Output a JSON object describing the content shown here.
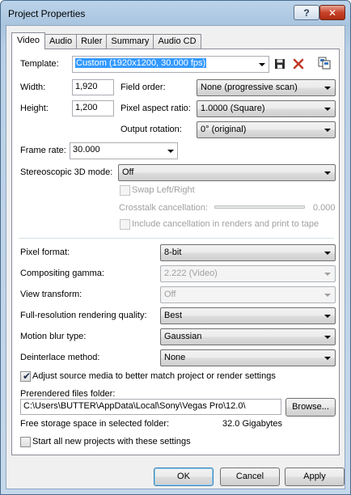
{
  "window": {
    "title": "Project Properties",
    "help_glyph": "?",
    "close_glyph": "✕"
  },
  "tabs": [
    {
      "label": "Video",
      "active": true
    },
    {
      "label": "Audio"
    },
    {
      "label": "Ruler"
    },
    {
      "label": "Summary"
    },
    {
      "label": "Audio CD"
    }
  ],
  "template": {
    "label": "Template:",
    "value": "Custom (1920x1200, 30.000 fps)"
  },
  "width": {
    "label": "Width:",
    "value": "1,920"
  },
  "height": {
    "label": "Height:",
    "value": "1,200"
  },
  "field_order": {
    "label": "Field order:",
    "value": "None (progressive scan)"
  },
  "pixel_aspect": {
    "label": "Pixel aspect ratio:",
    "value": "1.0000 (Square)"
  },
  "output_rotation": {
    "label": "Output rotation:",
    "value": "0° (original)"
  },
  "frame_rate": {
    "label": "Frame rate:",
    "value": "30.000"
  },
  "stereo_3d": {
    "label": "Stereoscopic 3D mode:",
    "value": "Off"
  },
  "swap_lr": {
    "label": "Swap Left/Right",
    "checked": false
  },
  "crosstalk": {
    "label": "Crosstalk cancellation:",
    "value": "0.000"
  },
  "include_cancellation": {
    "label": "Include cancellation in renders and print to tape",
    "checked": false
  },
  "pixel_format": {
    "label": "Pixel format:",
    "value": "8-bit"
  },
  "compositing_gamma": {
    "label": "Compositing gamma:",
    "value": "2.222 (Video)"
  },
  "view_transform": {
    "label": "View transform:",
    "value": "Off"
  },
  "render_quality": {
    "label": "Full-resolution rendering quality:",
    "value": "Best"
  },
  "motion_blur": {
    "label": "Motion blur type:",
    "value": "Gaussian"
  },
  "deinterlace": {
    "label": "Deinterlace method:",
    "value": "None"
  },
  "adjust_source": {
    "label": "Adjust source media to better match project or render settings",
    "checked": true,
    "mark": "✔"
  },
  "prerendered": {
    "label": "Prerendered files folder:",
    "value": "C:\\Users\\BUTTER\\AppData\\Local\\Sony\\Vegas Pro\\12.0\\",
    "browse_label": "Browse..."
  },
  "storage": {
    "label": "Free storage space in selected folder:",
    "value": "32.0 Gigabytes"
  },
  "start_all": {
    "label": "Start all new projects with these settings",
    "checked": false
  },
  "buttons": {
    "ok": "OK",
    "cancel": "Cancel",
    "apply": "Apply"
  },
  "colors": {
    "accent": "#3399ff",
    "delete": "#c0392b",
    "title_gradient": "#bcd4ea"
  }
}
